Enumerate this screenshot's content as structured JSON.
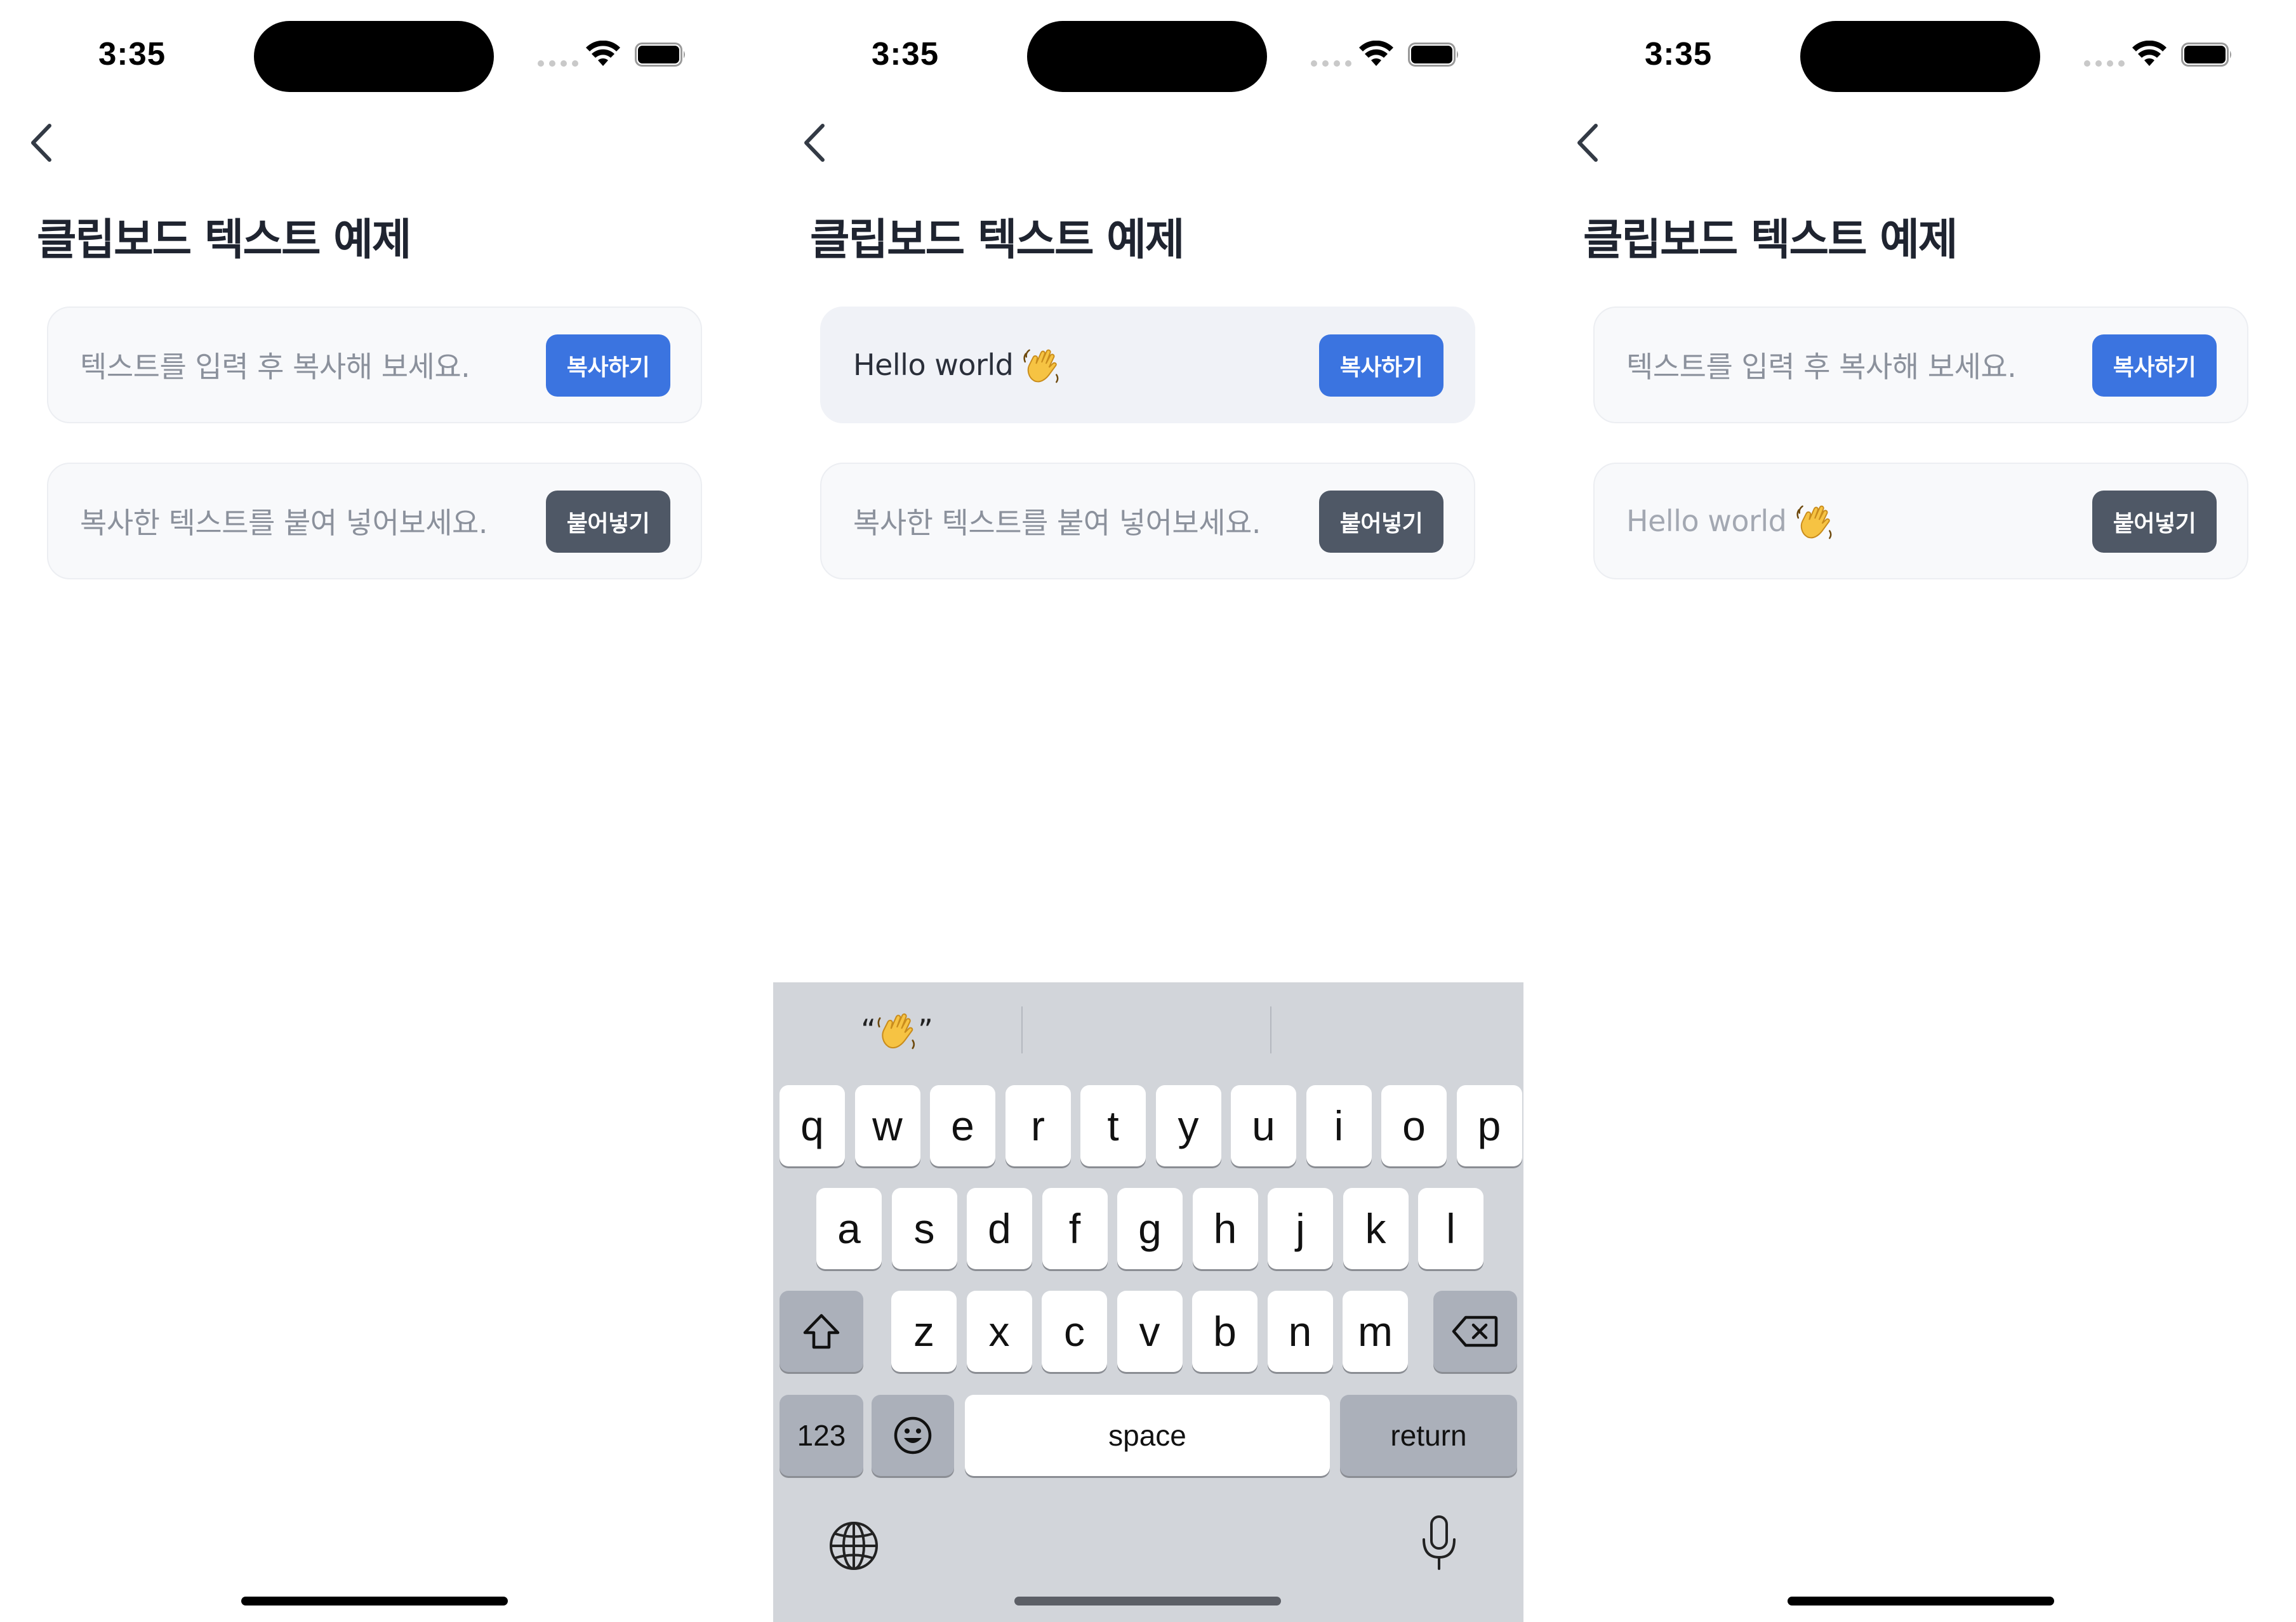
{
  "status_bar": {
    "time": "3:35"
  },
  "page": {
    "title": "클립보드 텍스트 예제"
  },
  "screens": [
    {
      "copy_field": {
        "value": "",
        "placeholder": "텍스트를 입력 후 복사해 보세요."
      },
      "copy_button": "복사하기",
      "paste_field": {
        "value": "",
        "placeholder": "복사한 텍스트를 붙여 넣어보세요."
      },
      "paste_button": "붙어넣기"
    },
    {
      "copy_field": {
        "value": "Hello world",
        "placeholder": "텍스트를 입력 후 복사해 보세요."
      },
      "copy_button": "복사하기",
      "paste_field": {
        "value": "",
        "placeholder": "복사한 텍스트를 붙여 넣어보세요."
      },
      "paste_button": "붙어넣기"
    },
    {
      "copy_field": {
        "value": "",
        "placeholder": "텍스트를 입력 후 복사해 보세요."
      },
      "copy_button": "복사하기",
      "paste_field": {
        "value": "Hello world",
        "placeholder": "복사한 텍스트를 붙여 넣어보세요."
      },
      "paste_button": "붙어넣기"
    }
  ],
  "keyboard": {
    "suggestion": {
      "open_quote": "“",
      "close_quote": "”",
      "icon": "waving-hand-icon"
    },
    "row1": [
      "q",
      "w",
      "e",
      "r",
      "t",
      "y",
      "u",
      "i",
      "o",
      "p"
    ],
    "row2": [
      "a",
      "s",
      "d",
      "f",
      "g",
      "h",
      "j",
      "k",
      "l"
    ],
    "row3": [
      "z",
      "x",
      "c",
      "v",
      "b",
      "n",
      "m"
    ],
    "numbers_key": "123",
    "space_key": "space",
    "return_key": "return"
  },
  "colors": {
    "primary_button": "#3b74e0",
    "secondary_button": "#4f5866",
    "keyboard_bg": "#d2d5da"
  }
}
